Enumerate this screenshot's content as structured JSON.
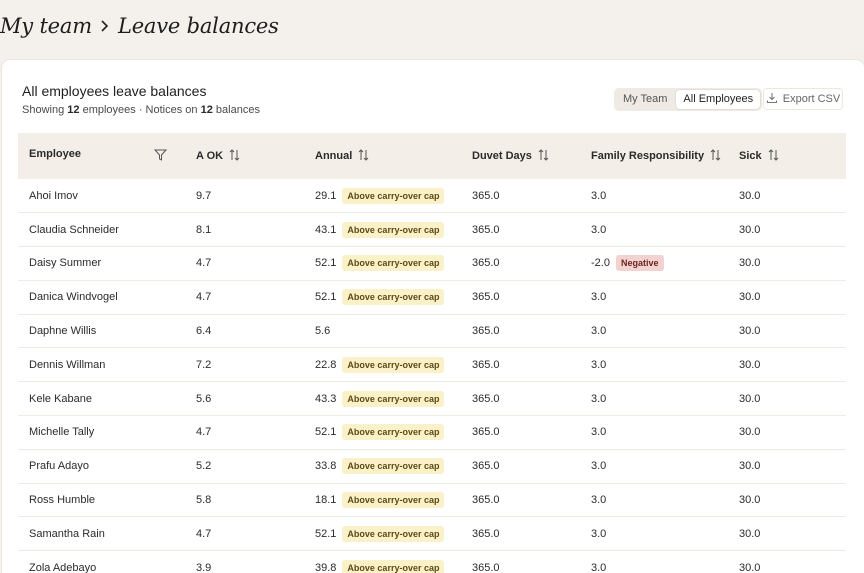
{
  "breadcrumb": {
    "parent": "My team",
    "current": "Leave balances"
  },
  "card": {
    "title": "All employees leave balances",
    "subtitle_prefix": "Showing",
    "employee_count": "12",
    "subtitle_mid": "employees · Notices on",
    "notice_count": "12",
    "subtitle_suffix": "balances"
  },
  "toggle": {
    "option1": "My Team",
    "option2": "All Employees",
    "selected": "All Employees"
  },
  "export_label": "Export CSV",
  "table": {
    "headers": [
      "Employee",
      "A OK",
      "Annual",
      "Duvet Days",
      "Family Responsibility",
      "Sick"
    ],
    "badge_cap": "Above carry-over cap",
    "badge_negative": "Negative",
    "rows": [
      {
        "name": "Ahoi Imov",
        "aok": "9.7",
        "annual": "29.1",
        "annual_badge": true,
        "duvet": "365.0",
        "family": "3.0",
        "family_badge": false,
        "sick": "30.0"
      },
      {
        "name": "Claudia Schneider",
        "aok": "8.1",
        "annual": "43.1",
        "annual_badge": true,
        "duvet": "365.0",
        "family": "3.0",
        "family_badge": false,
        "sick": "30.0"
      },
      {
        "name": "Daisy Summer",
        "aok": "4.7",
        "annual": "52.1",
        "annual_badge": true,
        "duvet": "365.0",
        "family": "-2.0",
        "family_badge": true,
        "sick": "30.0"
      },
      {
        "name": "Danica Windvogel",
        "aok": "4.7",
        "annual": "52.1",
        "annual_badge": true,
        "duvet": "365.0",
        "family": "3.0",
        "family_badge": false,
        "sick": "30.0"
      },
      {
        "name": "Daphne Willis",
        "aok": "6.4",
        "annual": "5.6",
        "annual_badge": false,
        "duvet": "365.0",
        "family": "3.0",
        "family_badge": false,
        "sick": "30.0"
      },
      {
        "name": "Dennis Willman",
        "aok": "7.2",
        "annual": "22.8",
        "annual_badge": true,
        "duvet": "365.0",
        "family": "3.0",
        "family_badge": false,
        "sick": "30.0"
      },
      {
        "name": "Kele Kabane",
        "aok": "5.6",
        "annual": "43.3",
        "annual_badge": true,
        "duvet": "365.0",
        "family": "3.0",
        "family_badge": false,
        "sick": "30.0"
      },
      {
        "name": "Michelle Tally",
        "aok": "4.7",
        "annual": "52.1",
        "annual_badge": true,
        "duvet": "365.0",
        "family": "3.0",
        "family_badge": false,
        "sick": "30.0"
      },
      {
        "name": "Prafu Adayo",
        "aok": "5.2",
        "annual": "33.8",
        "annual_badge": true,
        "duvet": "365.0",
        "family": "3.0",
        "family_badge": false,
        "sick": "30.0"
      },
      {
        "name": "Ross Humble",
        "aok": "5.8",
        "annual": "18.1",
        "annual_badge": true,
        "duvet": "365.0",
        "family": "3.0",
        "family_badge": false,
        "sick": "30.0"
      },
      {
        "name": "Samantha Rain",
        "aok": "4.7",
        "annual": "52.1",
        "annual_badge": true,
        "duvet": "365.0",
        "family": "3.0",
        "family_badge": false,
        "sick": "30.0"
      },
      {
        "name": "Zola Adebayo",
        "aok": "3.9",
        "annual": "39.8",
        "annual_badge": true,
        "duvet": "365.0",
        "family": "3.0",
        "family_badge": false,
        "sick": "30.0"
      }
    ]
  }
}
